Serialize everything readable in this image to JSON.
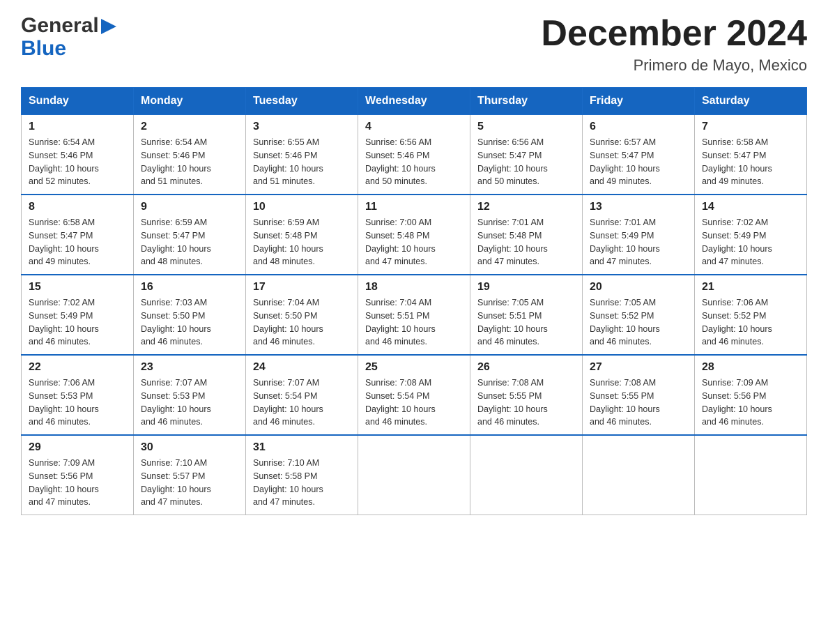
{
  "header": {
    "logo_line1": "General",
    "logo_line2": "Blue",
    "month": "December 2024",
    "location": "Primero de Mayo, Mexico"
  },
  "days_of_week": [
    "Sunday",
    "Monday",
    "Tuesday",
    "Wednesday",
    "Thursday",
    "Friday",
    "Saturday"
  ],
  "weeks": [
    [
      {
        "day": "1",
        "sunrise": "6:54 AM",
        "sunset": "5:46 PM",
        "daylight": "10 hours and 52 minutes."
      },
      {
        "day": "2",
        "sunrise": "6:54 AM",
        "sunset": "5:46 PM",
        "daylight": "10 hours and 51 minutes."
      },
      {
        "day": "3",
        "sunrise": "6:55 AM",
        "sunset": "5:46 PM",
        "daylight": "10 hours and 51 minutes."
      },
      {
        "day": "4",
        "sunrise": "6:56 AM",
        "sunset": "5:46 PM",
        "daylight": "10 hours and 50 minutes."
      },
      {
        "day": "5",
        "sunrise": "6:56 AM",
        "sunset": "5:47 PM",
        "daylight": "10 hours and 50 minutes."
      },
      {
        "day": "6",
        "sunrise": "6:57 AM",
        "sunset": "5:47 PM",
        "daylight": "10 hours and 49 minutes."
      },
      {
        "day": "7",
        "sunrise": "6:58 AM",
        "sunset": "5:47 PM",
        "daylight": "10 hours and 49 minutes."
      }
    ],
    [
      {
        "day": "8",
        "sunrise": "6:58 AM",
        "sunset": "5:47 PM",
        "daylight": "10 hours and 49 minutes."
      },
      {
        "day": "9",
        "sunrise": "6:59 AM",
        "sunset": "5:47 PM",
        "daylight": "10 hours and 48 minutes."
      },
      {
        "day": "10",
        "sunrise": "6:59 AM",
        "sunset": "5:48 PM",
        "daylight": "10 hours and 48 minutes."
      },
      {
        "day": "11",
        "sunrise": "7:00 AM",
        "sunset": "5:48 PM",
        "daylight": "10 hours and 47 minutes."
      },
      {
        "day": "12",
        "sunrise": "7:01 AM",
        "sunset": "5:48 PM",
        "daylight": "10 hours and 47 minutes."
      },
      {
        "day": "13",
        "sunrise": "7:01 AM",
        "sunset": "5:49 PM",
        "daylight": "10 hours and 47 minutes."
      },
      {
        "day": "14",
        "sunrise": "7:02 AM",
        "sunset": "5:49 PM",
        "daylight": "10 hours and 47 minutes."
      }
    ],
    [
      {
        "day": "15",
        "sunrise": "7:02 AM",
        "sunset": "5:49 PM",
        "daylight": "10 hours and 46 minutes."
      },
      {
        "day": "16",
        "sunrise": "7:03 AM",
        "sunset": "5:50 PM",
        "daylight": "10 hours and 46 minutes."
      },
      {
        "day": "17",
        "sunrise": "7:04 AM",
        "sunset": "5:50 PM",
        "daylight": "10 hours and 46 minutes."
      },
      {
        "day": "18",
        "sunrise": "7:04 AM",
        "sunset": "5:51 PM",
        "daylight": "10 hours and 46 minutes."
      },
      {
        "day": "19",
        "sunrise": "7:05 AM",
        "sunset": "5:51 PM",
        "daylight": "10 hours and 46 minutes."
      },
      {
        "day": "20",
        "sunrise": "7:05 AM",
        "sunset": "5:52 PM",
        "daylight": "10 hours and 46 minutes."
      },
      {
        "day": "21",
        "sunrise": "7:06 AM",
        "sunset": "5:52 PM",
        "daylight": "10 hours and 46 minutes."
      }
    ],
    [
      {
        "day": "22",
        "sunrise": "7:06 AM",
        "sunset": "5:53 PM",
        "daylight": "10 hours and 46 minutes."
      },
      {
        "day": "23",
        "sunrise": "7:07 AM",
        "sunset": "5:53 PM",
        "daylight": "10 hours and 46 minutes."
      },
      {
        "day": "24",
        "sunrise": "7:07 AM",
        "sunset": "5:54 PM",
        "daylight": "10 hours and 46 minutes."
      },
      {
        "day": "25",
        "sunrise": "7:08 AM",
        "sunset": "5:54 PM",
        "daylight": "10 hours and 46 minutes."
      },
      {
        "day": "26",
        "sunrise": "7:08 AM",
        "sunset": "5:55 PM",
        "daylight": "10 hours and 46 minutes."
      },
      {
        "day": "27",
        "sunrise": "7:08 AM",
        "sunset": "5:55 PM",
        "daylight": "10 hours and 46 minutes."
      },
      {
        "day": "28",
        "sunrise": "7:09 AM",
        "sunset": "5:56 PM",
        "daylight": "10 hours and 46 minutes."
      }
    ],
    [
      {
        "day": "29",
        "sunrise": "7:09 AM",
        "sunset": "5:56 PM",
        "daylight": "10 hours and 47 minutes."
      },
      {
        "day": "30",
        "sunrise": "7:10 AM",
        "sunset": "5:57 PM",
        "daylight": "10 hours and 47 minutes."
      },
      {
        "day": "31",
        "sunrise": "7:10 AM",
        "sunset": "5:58 PM",
        "daylight": "10 hours and 47 minutes."
      },
      null,
      null,
      null,
      null
    ]
  ],
  "labels": {
    "sunrise": "Sunrise:",
    "sunset": "Sunset:",
    "daylight": "Daylight:"
  }
}
